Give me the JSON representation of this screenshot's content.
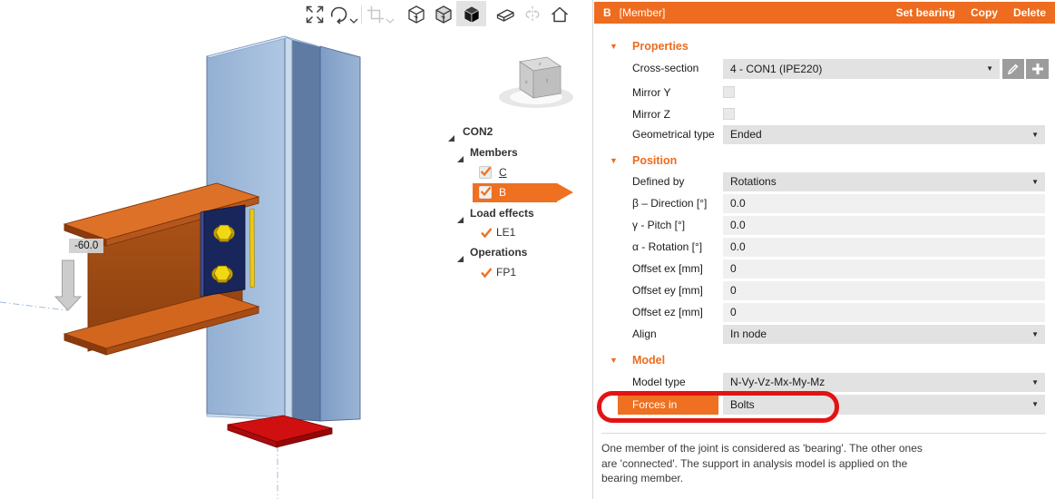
{
  "accent": "#ED6C1F",
  "toolbar": {
    "buttons": [
      {
        "name": "fit-view",
        "state": "enabled"
      },
      {
        "name": "orbit-rotate",
        "state": "enabled",
        "has_dropdown": true
      },
      {
        "name": "section-crop",
        "state": "disabled",
        "has_dropdown": true
      },
      {
        "name": "wireframe-view",
        "state": "enabled"
      },
      {
        "name": "transparent-view",
        "state": "enabled"
      },
      {
        "name": "solid-view",
        "state": "selected"
      },
      {
        "name": "cut-wedge-view",
        "state": "enabled"
      },
      {
        "name": "mirror-view",
        "state": "disabled"
      },
      {
        "name": "home-view",
        "state": "enabled"
      }
    ]
  },
  "viewport": {
    "load_label": "-60.0",
    "members": [
      "column (bearing, blue)",
      "beam B (orange)",
      "fin plate with 2 bolts",
      "red base plate support"
    ]
  },
  "tree": {
    "root": "CON2",
    "groups": [
      {
        "label": "Members",
        "items": [
          {
            "label": "C",
            "checked": true,
            "selected": false
          },
          {
            "label": "B",
            "checked": true,
            "selected": true
          }
        ]
      },
      {
        "label": "Load effects",
        "items": [
          {
            "label": "LE1",
            "checked": true
          }
        ]
      },
      {
        "label": "Operations",
        "items": [
          {
            "label": "FP1",
            "checked": true
          }
        ]
      }
    ]
  },
  "panel": {
    "header": {
      "title": "B",
      "subtitle": "[Member]",
      "actions": [
        "Set bearing",
        "Copy",
        "Delete"
      ]
    },
    "sections": [
      {
        "title": "Properties"
      },
      {
        "title": "Position"
      },
      {
        "title": "Model"
      }
    ],
    "fields": {
      "cross_section": {
        "label": "Cross-section",
        "value": "4 - CON1 (IPE220)"
      },
      "mirror_y": {
        "label": "Mirror Y",
        "checked": false
      },
      "mirror_z": {
        "label": "Mirror Z",
        "checked": false
      },
      "geometrical_type": {
        "label": "Geometrical type",
        "value": "Ended"
      },
      "defined_by": {
        "label": "Defined by",
        "value": "Rotations"
      },
      "beta": {
        "label": "β – Direction [°]",
        "value": "0.0"
      },
      "gamma": {
        "label": "γ - Pitch [°]",
        "value": "0.0"
      },
      "alpha": {
        "label": "α - Rotation [°]",
        "value": "0.0"
      },
      "offset_ex": {
        "label": "Offset ex [mm]",
        "value": "0"
      },
      "offset_ey": {
        "label": "Offset ey [mm]",
        "value": "0"
      },
      "offset_ez": {
        "label": "Offset ez [mm]",
        "value": "0"
      },
      "align": {
        "label": "Align",
        "value": "In node"
      },
      "model_type": {
        "label": "Model type",
        "value": "N-Vy-Vz-Mx-My-Mz"
      },
      "forces_in": {
        "label": "Forces in",
        "value": "Bolts",
        "highlighted": true
      }
    },
    "help_text": "One member of the joint is considered as 'bearing'. The other ones are 'connected'. The support in analysis model is applied on the bearing member."
  }
}
